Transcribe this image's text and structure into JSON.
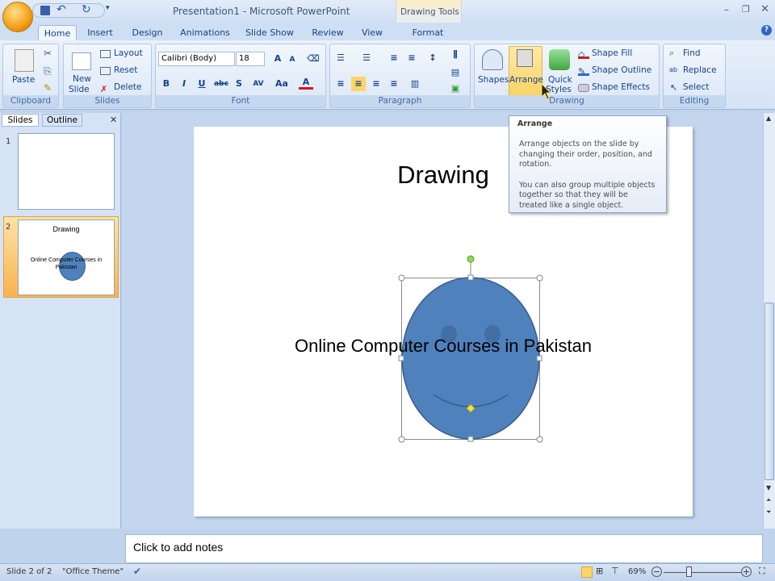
{
  "window": {
    "title": "Presentation1  -  Microsoft PowerPoint",
    "contextual_tab_group": "Drawing Tools"
  },
  "tabs": [
    "Home",
    "Insert",
    "Design",
    "Animations",
    "Slide Show",
    "Review",
    "View",
    "Format"
  ],
  "ribbon": {
    "clipboard": {
      "label": "Clipboard",
      "paste": "Paste"
    },
    "slides": {
      "label": "Slides",
      "new_slide_1": "New",
      "new_slide_2": "Slide",
      "layout": "Layout",
      "reset": "Reset",
      "delete": "Delete"
    },
    "font": {
      "label": "Font",
      "font_name": "Calibri (Body)",
      "font_size": "18",
      "bold": "B",
      "italic": "I",
      "underline": "U",
      "strike": "abc",
      "shadow": "S",
      "spacing": "AV",
      "case": "Aa",
      "color": "A"
    },
    "paragraph": {
      "label": "Paragraph"
    },
    "drawing": {
      "label": "Drawing",
      "shapes": "Shapes",
      "arrange": "Arrange",
      "quick_1": "Quick",
      "quick_2": "Styles",
      "shape_fill": "Shape Fill",
      "shape_outline": "Shape Outline",
      "shape_effects": "Shape Effects"
    },
    "editing": {
      "label": "Editing",
      "find": "Find",
      "replace": "Replace",
      "select": "Select"
    }
  },
  "tooltip": {
    "title": "Arrange",
    "p1": "Arrange objects on the slide by changing their order, position, and rotation.",
    "p2": "You can also group multiple objects together so that they will be treated like a single object."
  },
  "panel": {
    "tabs": [
      "Slides",
      "Outline"
    ],
    "slides": [
      {
        "num": "1"
      },
      {
        "num": "2",
        "title": "Drawing",
        "text": "Online Computer Courses in Pakistan"
      }
    ]
  },
  "slide": {
    "title": "Drawing",
    "text": "Online Computer Courses in Pakistan"
  },
  "notes": {
    "placeholder": "Click to add notes"
  },
  "status": {
    "slide": "Slide 2 of 2",
    "theme": "\"Office Theme\"",
    "zoom": "69%",
    "zoom_fraction": 0.69
  },
  "colors": {
    "accent": "#4f81bd",
    "highlight": "#fcd567"
  }
}
